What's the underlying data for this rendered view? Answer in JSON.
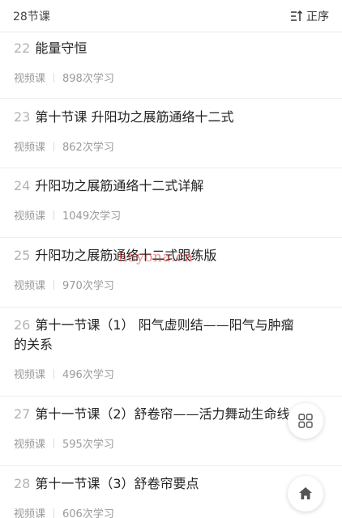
{
  "header": {
    "count_label": "28节课",
    "sort_label": "正序"
  },
  "lessons": [
    {
      "num": "22",
      "title": "能量守恒",
      "type": "视频课",
      "views": "898次学习"
    },
    {
      "num": "23",
      "title": "第十节课 升阳功之展筋通络十二式",
      "type": "视频课",
      "views": "862次学习"
    },
    {
      "num": "24",
      "title": "升阳功之展筋通络十二式详解",
      "type": "视频课",
      "views": "1049次学习"
    },
    {
      "num": "25",
      "title": "升阳功之展筋通络十二式跟练版",
      "type": "视频课",
      "views": "970次学习"
    },
    {
      "num": "26",
      "title": "第十一节课（1） 阳气虚则结——阳气与肿瘤",
      "title2": "的关系",
      "type": "视频课",
      "views": "496次学习"
    },
    {
      "num": "27",
      "title": "第十一节课（2）舒卷帘——活力舞动生命线",
      "type": "视频课",
      "views": "595次学习"
    },
    {
      "num": "28",
      "title": "第十一节课（3）舒卷帘要点",
      "type": "视频课",
      "views": "606次学习"
    }
  ],
  "watermark": "hayona.cn",
  "icons": {
    "sort": "sort-order-icon",
    "grid": "grid-icon",
    "home": "home-icon"
  }
}
